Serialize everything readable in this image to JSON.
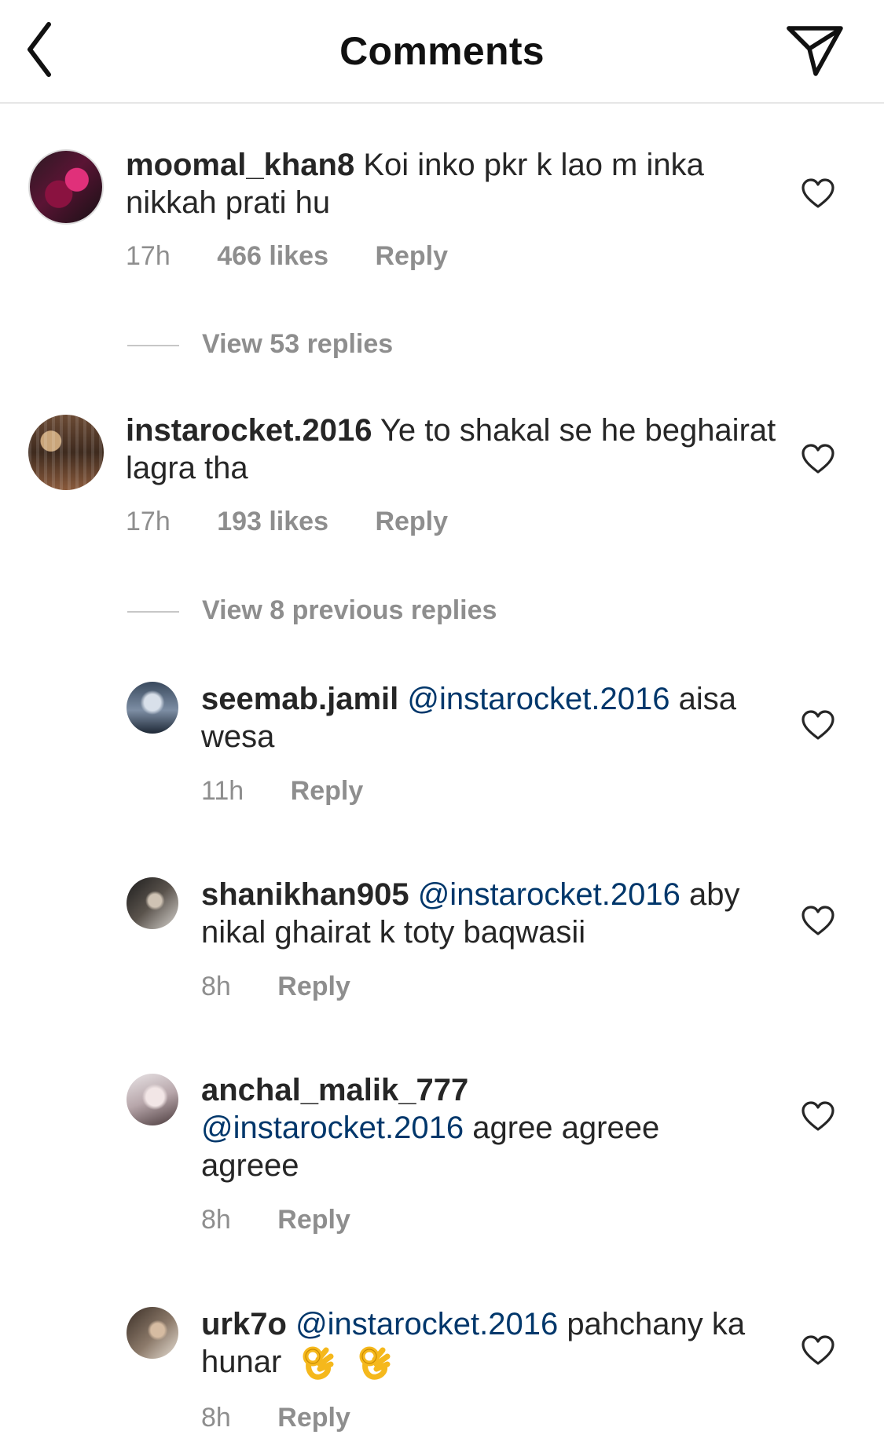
{
  "header": {
    "title": "Comments",
    "back_icon": "chevron-left-icon",
    "send_icon": "paper-plane-icon"
  },
  "colors": {
    "text": "#262626",
    "meta": "#8e8e8e",
    "mention": "#00376b",
    "divider": "#e6e6e6"
  },
  "comments": [
    {
      "username": "moomal_khan8",
      "text": "Koi inko pkr k lao m inka nikkah prati hu",
      "time": "17h",
      "likes": "466 likes",
      "reply_label": "Reply",
      "view_replies": "View 53 replies"
    },
    {
      "username": "instarocket.2016",
      "text": "Ye to shakal se he beghairat lagra tha",
      "time": "17h",
      "likes": "193 likes",
      "reply_label": "Reply",
      "view_replies": "View 8 previous replies",
      "replies": [
        {
          "username": "seemab.jamil",
          "mention": "@instarocket.2016",
          "text": "aisa wesa",
          "time": "11h",
          "reply_label": "Reply"
        },
        {
          "username": "shanikhan905",
          "mention": "@instarocket.2016",
          "text": "aby nikal ghairat k toty baqwasii",
          "time": "8h",
          "reply_label": "Reply"
        },
        {
          "username": "anchal_malik_777",
          "mention": "@instarocket.2016",
          "text": "agree agreee agreee",
          "time": "8h",
          "reply_label": "Reply"
        },
        {
          "username": "urk7o",
          "mention": "@instarocket.2016",
          "text": "pahchany ka hunar",
          "emoji": "ok-hand-emoji x2",
          "time": "8h",
          "reply_label": "Reply"
        }
      ]
    }
  ]
}
